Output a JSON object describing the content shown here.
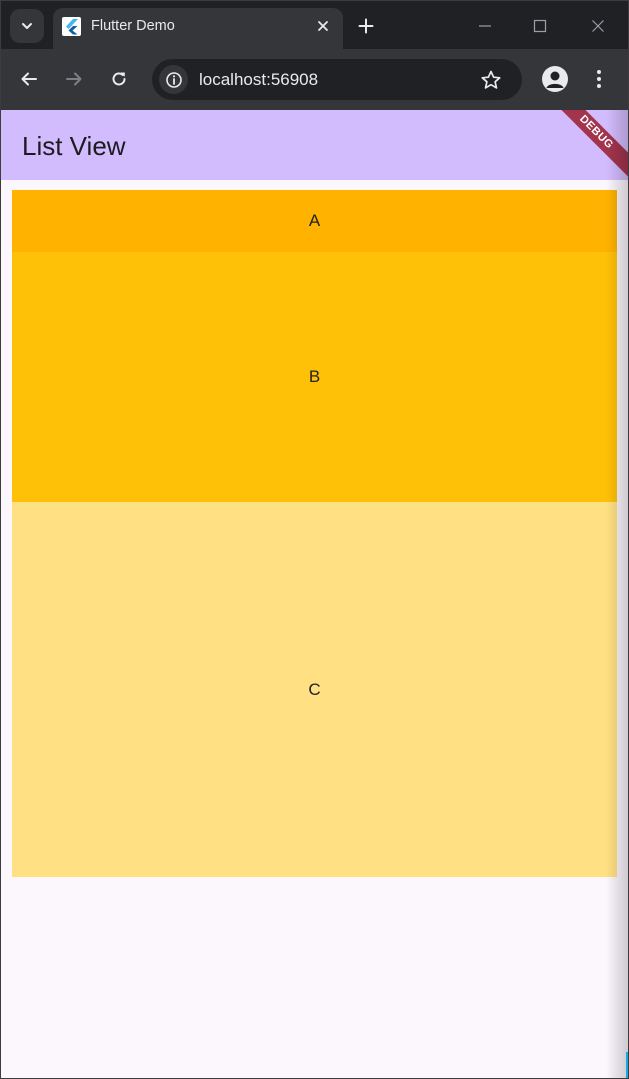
{
  "browser": {
    "tab": {
      "title": "Flutter Demo",
      "favicon": "flutter-logo",
      "close_icon": "close-icon"
    },
    "toolbar": {
      "url": "localhost:56908"
    },
    "colors": {
      "frame": "#202124",
      "toolbar": "#35363a",
      "text": "#e8eaed"
    }
  },
  "app": {
    "appbar": {
      "title": "List View"
    },
    "debug_banner": {
      "label": "DEBUG"
    },
    "list": {
      "items": [
        {
          "label": "A",
          "color": "#ffb300"
        },
        {
          "label": "B",
          "color": "#ffc107"
        },
        {
          "label": "C",
          "color": "#ffe082"
        }
      ]
    },
    "colors": {
      "appbar": "#d3bcfd",
      "background": "#fcf6fd",
      "banner": "#a3344e"
    }
  }
}
